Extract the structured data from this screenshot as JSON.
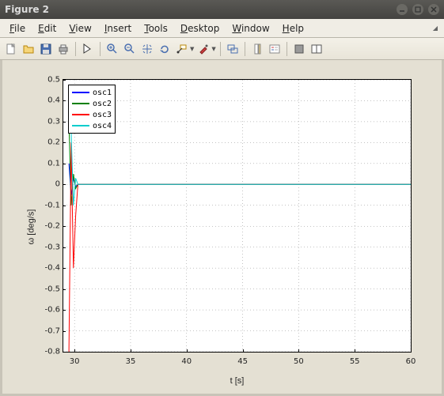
{
  "window": {
    "title": "Figure 2"
  },
  "menu": {
    "file": "File",
    "edit": "Edit",
    "view": "View",
    "insert": "Insert",
    "tools": "Tools",
    "desktop": "Desktop",
    "window": "Window",
    "help": "Help"
  },
  "chart_data": {
    "type": "line",
    "title": "",
    "xlabel": "t [s]",
    "ylabel": "ω [deg/s]",
    "xlim": [
      29,
      60
    ],
    "ylim": [
      -0.8,
      0.5
    ],
    "xticks": [
      30,
      35,
      40,
      45,
      50,
      55,
      60
    ],
    "yticks": [
      -0.8,
      -0.7,
      -0.6,
      -0.5,
      -0.4,
      -0.3,
      -0.2,
      -0.1,
      0,
      0.1,
      0.2,
      0.3,
      0.4,
      0.5
    ],
    "grid": true,
    "grid_style": "dotted",
    "legend": {
      "position": "upper-left",
      "entries": [
        "osc1",
        "osc2",
        "osc3",
        "osc4"
      ]
    },
    "series": [
      {
        "name": "osc1",
        "color": "#0000ff",
        "x": [
          29.5,
          29.7,
          29.9,
          30.1,
          30.3,
          60
        ],
        "values": [
          0.1,
          -0.05,
          0.03,
          -0.01,
          0.0,
          0.0
        ]
      },
      {
        "name": "osc2",
        "color": "#008000",
        "x": [
          29.5,
          29.7,
          29.9,
          30.1,
          30.3,
          60
        ],
        "values": [
          0.3,
          -0.1,
          0.05,
          -0.02,
          0.0,
          0.0
        ]
      },
      {
        "name": "osc3",
        "color": "#ff0000",
        "x": [
          29.5,
          29.7,
          29.9,
          30.1,
          30.3,
          60
        ],
        "values": [
          -0.8,
          0.2,
          -0.4,
          -0.15,
          0.0,
          0.0
        ]
      },
      {
        "name": "osc4",
        "color": "#00cdcd",
        "x": [
          29.5,
          29.7,
          29.9,
          30.1,
          30.3,
          60
        ],
        "values": [
          0.3,
          0.25,
          -0.1,
          0.03,
          0.0,
          0.0
        ]
      }
    ]
  }
}
